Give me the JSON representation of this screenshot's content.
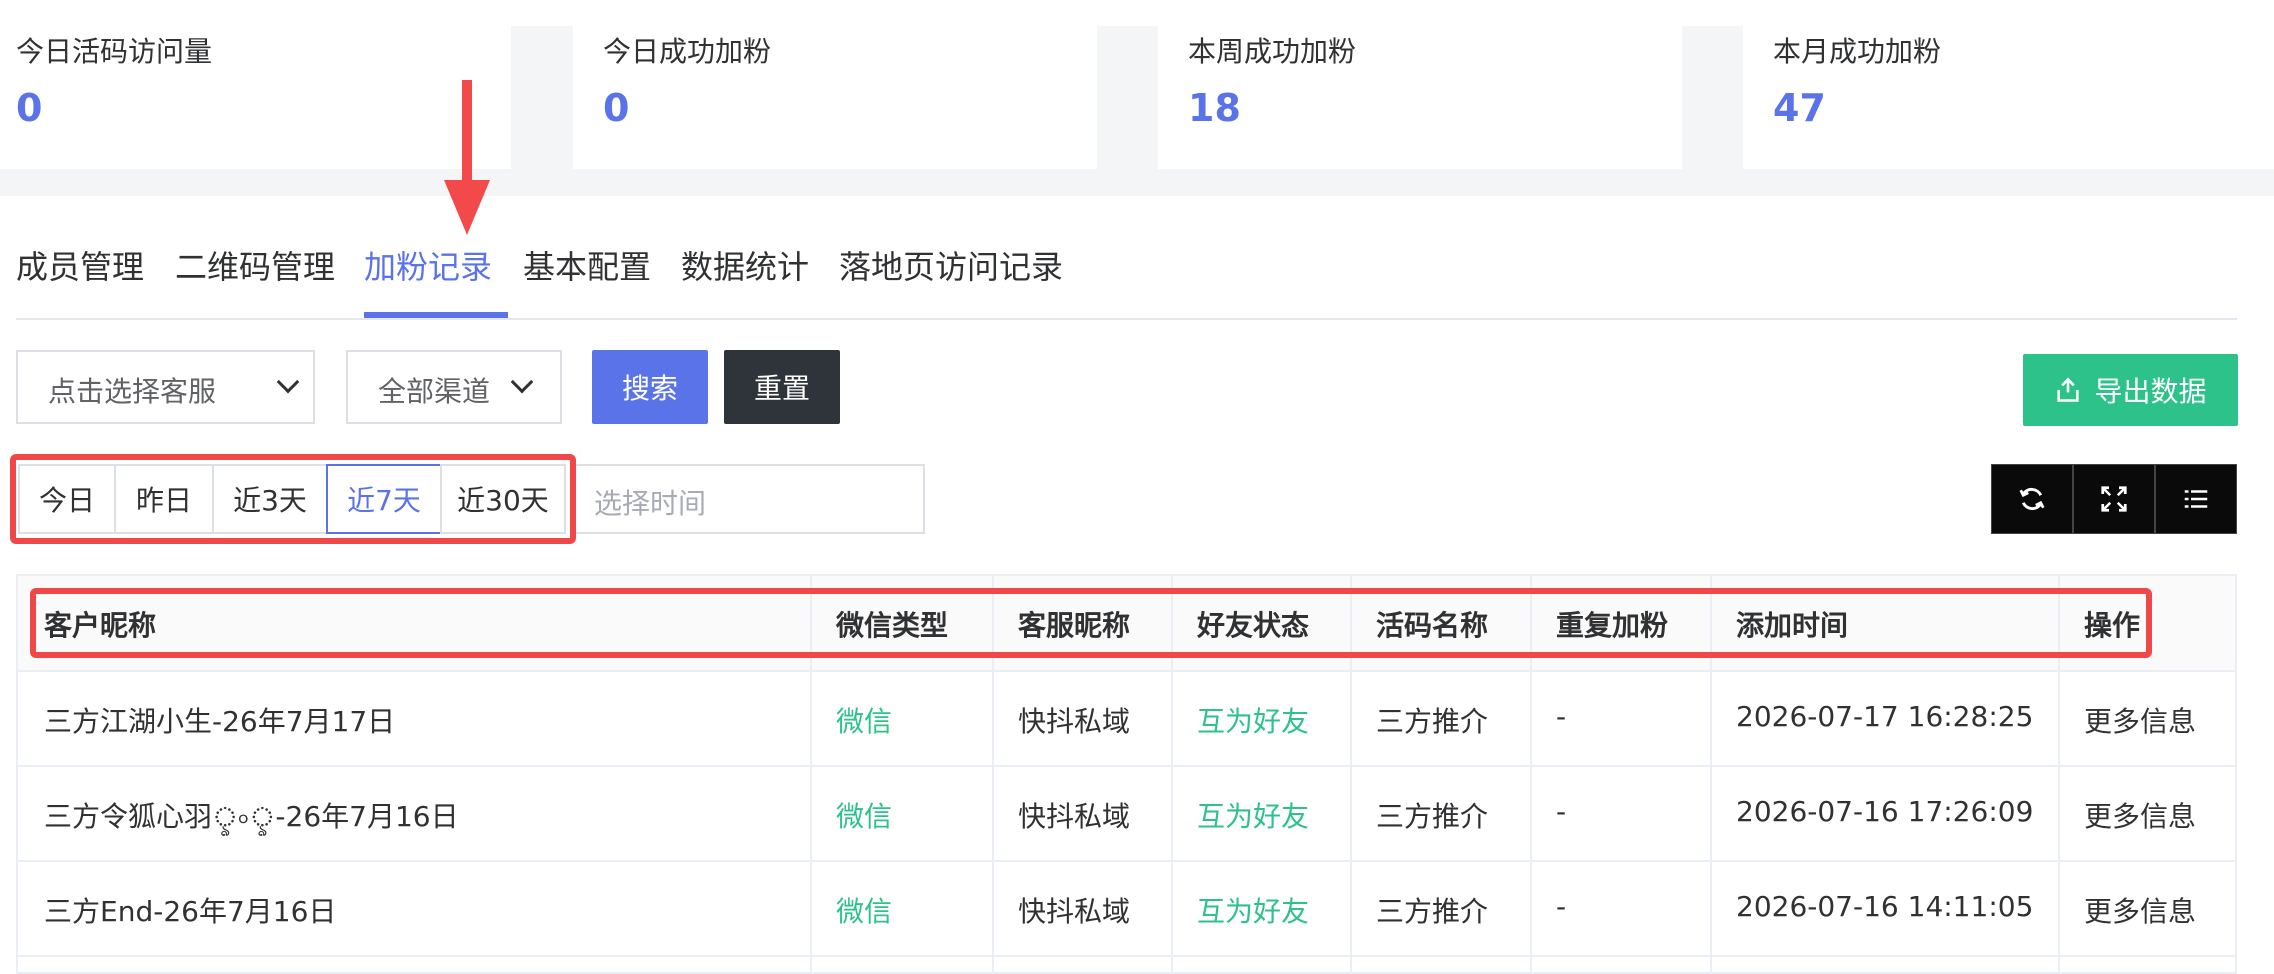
{
  "stats": [
    {
      "label": "今日活码访问量",
      "value": "0"
    },
    {
      "label": "今日成功加粉",
      "value": "0"
    },
    {
      "label": "本周成功加粉",
      "value": "18"
    },
    {
      "label": "本月成功加粉",
      "value": "47"
    }
  ],
  "tabs": [
    {
      "label": "成员管理",
      "active": false
    },
    {
      "label": "二维码管理",
      "active": false
    },
    {
      "label": "加粉记录",
      "active": true
    },
    {
      "label": "基本配置",
      "active": false
    },
    {
      "label": "数据统计",
      "active": false
    },
    {
      "label": "落地页访问记录",
      "active": false
    }
  ],
  "filters": {
    "agent_select": "点击选择客服",
    "channel_select": "全部渠道",
    "search_label": "搜索",
    "reset_label": "重置",
    "export_label": "导出数据"
  },
  "date_range": {
    "options": [
      "今日",
      "昨日",
      "近3天",
      "近7天",
      "近30天"
    ],
    "selected": "近7天",
    "placeholder": "选择时间"
  },
  "toolbar": [
    "refresh-icon",
    "fullscreen-icon",
    "columns-icon"
  ],
  "table": {
    "columns": [
      "客户昵称",
      "微信类型",
      "客服昵称",
      "好友状态",
      "活码名称",
      "重复加粉",
      "添加时间",
      "操作"
    ],
    "rows": [
      [
        "三方江湖小生-26年7月17日",
        "微信",
        "快抖私域",
        "互为好友",
        "三方推介",
        "-",
        "2026-07-17 16:28:25",
        "更多信息"
      ],
      [
        "三方令狐心羽ৢ৹ৢ-26年7月16日",
        "微信",
        "快抖私域",
        "互为好友",
        "三方推介",
        "-",
        "2026-07-16 17:26:09",
        "更多信息"
      ],
      [
        "三方End-26年7月16日",
        "微信",
        "快抖私域",
        "互为好友",
        "三方推介",
        "-",
        "2026-07-16 14:11:05",
        "更多信息"
      ]
    ]
  },
  "colors": {
    "accent": "#5b73e8",
    "success": "#2ec28b",
    "highlight": "#f04848",
    "dark_button": "#2f343b"
  }
}
